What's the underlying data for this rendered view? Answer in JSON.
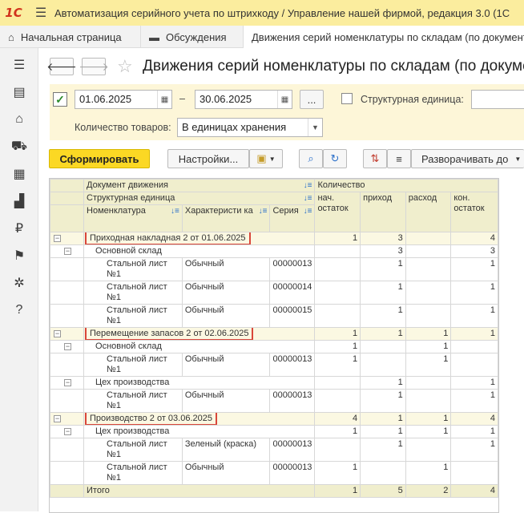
{
  "app": {
    "logo": "1С",
    "title": "Автоматизация серийного учета по штрихкоду / Управление нашей фирмой, редакция 3.0  (1С"
  },
  "tabs": [
    {
      "label": "Начальная страница",
      "icon": "home-icon"
    },
    {
      "label": "Обсуждения",
      "icon": "chat-icon"
    },
    {
      "label": "Движения серий номенклатуры по складам (по документ",
      "icon": ""
    }
  ],
  "sidebar": [
    "menu-icon",
    "contacts-icon",
    "basket-icon",
    "cart-icon",
    "dashboard-icon",
    "factory-icon",
    "ruble-icon",
    "flag-icon",
    "gear-icon",
    "help-icon"
  ],
  "page": {
    "title": "Движения серий номенклатуры по складам (по докуме"
  },
  "filters": {
    "period_checked": true,
    "date_from": "01.06.2025",
    "date_sep": "–",
    "date_to": "30.06.2025",
    "ellipsis": "...",
    "struct_unit_label": "Структурная единица:",
    "qty_label": "Количество товаров:",
    "qty_value": "В единицах хранения"
  },
  "toolbar": {
    "generate": "Сформировать",
    "settings": "Настройки...",
    "expand_to": "Разворачивать до"
  },
  "grid": {
    "headers": {
      "doc": "Документ движения",
      "unit": "Структурная единица",
      "item": "Номенклатура",
      "char": "Характеристи ка",
      "series": "Серия",
      "qty": "Количество",
      "start": "нач. остаток",
      "income": "приход",
      "expense": "расход",
      "end": "кон. остаток"
    },
    "groups": [
      {
        "doc": "Приходная накладная 2 от 01.06.2025",
        "start": "1",
        "income": "3",
        "expense": "",
        "end": "4",
        "units": [
          {
            "name": "Основной склад",
            "start": "",
            "income": "3",
            "expense": "",
            "end": "3",
            "rows": [
              {
                "item": "Стальной лист №1",
                "char": "Обычный",
                "series": "00000013",
                "start": "",
                "income": "1",
                "expense": "",
                "end": "1"
              },
              {
                "item": "Стальной лист №1",
                "char": "Обычный",
                "series": "00000014",
                "start": "",
                "income": "1",
                "expense": "",
                "end": "1"
              },
              {
                "item": "Стальной лист №1",
                "char": "Обычный",
                "series": "00000015",
                "start": "",
                "income": "1",
                "expense": "",
                "end": "1"
              }
            ]
          }
        ]
      },
      {
        "doc": "Перемещение запасов 2 от 02.06.2025",
        "start": "1",
        "income": "1",
        "expense": "1",
        "end": "1",
        "units": [
          {
            "name": "Основной склад",
            "start": "1",
            "income": "",
            "expense": "1",
            "end": "",
            "rows": [
              {
                "item": "Стальной лист №1",
                "char": "Обычный",
                "series": "00000013",
                "start": "1",
                "income": "",
                "expense": "1",
                "end": ""
              }
            ]
          },
          {
            "name": "Цех производства",
            "start": "",
            "income": "1",
            "expense": "",
            "end": "1",
            "rows": [
              {
                "item": "Стальной лист №1",
                "char": "Обычный",
                "series": "00000013",
                "start": "",
                "income": "1",
                "expense": "",
                "end": "1"
              }
            ]
          }
        ]
      },
      {
        "doc": "Производство 2 от 03.06.2025",
        "start": "4",
        "income": "1",
        "expense": "1",
        "end": "4",
        "units": [
          {
            "name": "Цех производства",
            "start": "1",
            "income": "1",
            "expense": "1",
            "end": "1",
            "rows": [
              {
                "item": "Стальной лист №1",
                "char": "Зеленый (краска)",
                "series": "00000013",
                "start": "",
                "income": "1",
                "expense": "",
                "end": "1"
              },
              {
                "item": "Стальной лист №1",
                "char": "Обычный",
                "series": "00000013",
                "start": "1",
                "income": "",
                "expense": "1",
                "end": ""
              }
            ]
          }
        ]
      }
    ],
    "total": {
      "label": "Итого",
      "start": "1",
      "income": "5",
      "expense": "2",
      "end": "4"
    }
  },
  "colors": {
    "titlebar": "#fbed9e",
    "primary": "#fbd824",
    "highlight": "#d9463a",
    "header": "#f0eecd"
  }
}
